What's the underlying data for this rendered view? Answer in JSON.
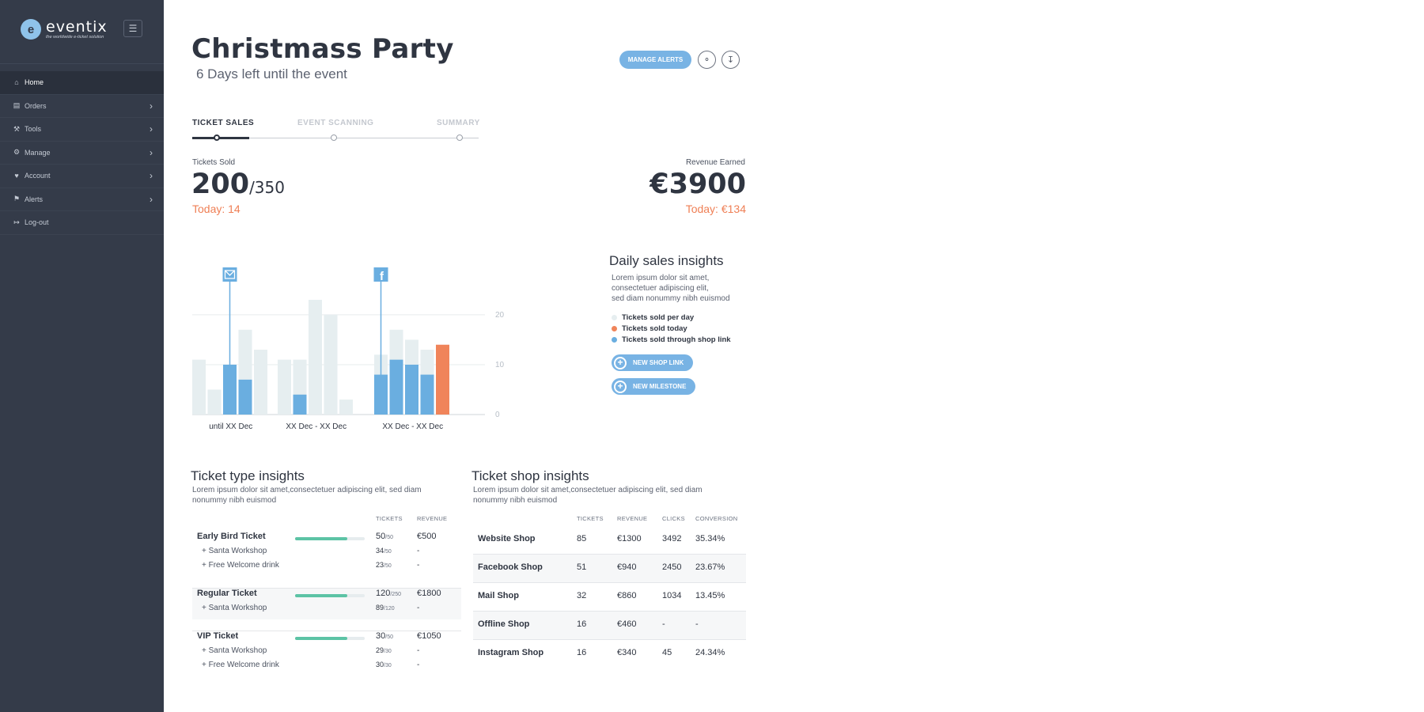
{
  "sidebar": {
    "logo_text": "eventix",
    "logo_tagline": "the worldwide e-ticket solution",
    "items": [
      {
        "label": "Home",
        "icon": "home-icon"
      },
      {
        "label": "Orders",
        "icon": "orders-icon"
      },
      {
        "label": "Tools",
        "icon": "wrench-icon"
      },
      {
        "label": "Manage",
        "icon": "gears-icon"
      },
      {
        "label": "Account",
        "icon": "heart-icon"
      },
      {
        "label": "Alerts",
        "icon": "bell-icon"
      },
      {
        "label": "Log-out",
        "icon": "logout-icon"
      }
    ]
  },
  "header": {
    "title": "Christmass Party",
    "subtitle": "6 Days left until the event",
    "manage_alerts": "MANAGE ALERTS"
  },
  "steps": [
    "TICKET SALES",
    "EVENT SCANNING",
    "SUMMARY"
  ],
  "kpis": {
    "tickets_label": "Tickets Sold",
    "tickets_sold": "200",
    "tickets_total": "/350",
    "tickets_today": "Today: 14",
    "revenue_label": "Revenue Earned",
    "revenue": "€3900",
    "revenue_today": "Today: €134"
  },
  "chart_data": {
    "type": "bar",
    "categories": [
      "until XX Dec",
      "XX Dec - XX Dec",
      "XX Dec - XX Dec"
    ],
    "y_ticks": [
      "20",
      "10",
      "0"
    ],
    "ylim": [
      0,
      20
    ],
    "grid": true,
    "groups": [
      {
        "per_day": [
          11,
          5,
          10,
          17,
          13
        ],
        "shop_link": [
          0,
          0,
          10,
          7,
          0
        ],
        "today": [
          0,
          0,
          0,
          0,
          0
        ]
      },
      {
        "per_day": [
          11,
          11,
          23,
          20,
          3
        ],
        "shop_link": [
          0,
          4,
          0,
          0,
          0
        ],
        "today": [
          0,
          0,
          0,
          0,
          0
        ]
      },
      {
        "per_day": [
          12,
          17,
          15,
          13,
          9
        ],
        "shop_link": [
          8,
          11,
          10,
          8,
          0
        ],
        "today": [
          0,
          0,
          0,
          0,
          14
        ]
      }
    ],
    "series": [
      {
        "name": "Tickets sold per day",
        "color": "#e6eef0"
      },
      {
        "name": "Tickets sold today",
        "color": "#f0845a"
      },
      {
        "name": "Tickets sold through shop link",
        "color": "#6aaee0"
      }
    ],
    "annotations": [
      {
        "group": 0,
        "bar": 2,
        "icon": "mail-icon"
      },
      {
        "group": 2,
        "bar": 0,
        "icon": "facebook-icon"
      }
    ]
  },
  "daily": {
    "title": "Daily sales insights",
    "desc_lines": [
      "Lorem ipsum dolor sit amet,",
      "consectetuer adipiscing elit,",
      "sed diam nonummy nibh euismod"
    ],
    "legend": [
      "Tickets sold per day",
      "Tickets sold today",
      "Tickets sold through shop link"
    ],
    "new_shop_link": "NEW SHOP LINK",
    "new_milestone": "NEW MILESTONE"
  },
  "ticket_types": {
    "title": "Ticket type insights",
    "desc_lines": [
      "Lorem ipsum dolor sit amet,consectetuer adipiscing elit, sed diam",
      "nonummy nibh euismod"
    ],
    "headers": [
      "TICKETS",
      "REVENUE"
    ],
    "rows": [
      {
        "name": "Early Bird Ticket",
        "sold": "50",
        "of": "/50",
        "revenue": "€500",
        "fill": 0.75
      },
      {
        "name": "+ Santa Workshop",
        "sold": "34",
        "of": "/50",
        "revenue": "-"
      },
      {
        "name": "+ Free Welcome drink",
        "sold": "23",
        "of": "/50",
        "revenue": "-"
      },
      {
        "name": "Regular Ticket",
        "sold": "120",
        "of": "/250",
        "revenue": "€1800",
        "fill": 0.75
      },
      {
        "name": "+ Santa Workshop",
        "sold": "89",
        "of": "/120",
        "revenue": "-"
      },
      {
        "name": "VIP Ticket",
        "sold": "30",
        "of": "/50",
        "revenue": "€1050",
        "fill": 0.75
      },
      {
        "name": "+ Santa Workshop",
        "sold": "29",
        "of": "/30",
        "revenue": "-"
      },
      {
        "name": "+ Free Welcome drink",
        "sold": "30",
        "of": "/30",
        "revenue": "-"
      }
    ]
  },
  "shops": {
    "title": "Ticket shop insights",
    "desc_lines": [
      "Lorem ipsum dolor sit amet,consectetuer adipiscing elit, sed diam",
      "nonummy nibh euismod"
    ],
    "headers": [
      "TICKETS",
      "REVENUE",
      "CLICKS",
      "CONVERSION"
    ],
    "rows": [
      {
        "name": "Website Shop",
        "tickets": "85",
        "revenue": "€1300",
        "clicks": "3492",
        "conversion": "35.34%"
      },
      {
        "name": "Facebook Shop",
        "tickets": "51",
        "revenue": "€940",
        "clicks": "2450",
        "conversion": "23.67%"
      },
      {
        "name": "Mail Shop",
        "tickets": "32",
        "revenue": "€860",
        "clicks": "1034",
        "conversion": "13.45%"
      },
      {
        "name": "Offline Shop",
        "tickets": "16",
        "revenue": "€460",
        "clicks": "-",
        "conversion": "-"
      },
      {
        "name": "Instagram Shop",
        "tickets": "16",
        "revenue": "€340",
        "clicks": "45",
        "conversion": "24.34%"
      }
    ]
  }
}
